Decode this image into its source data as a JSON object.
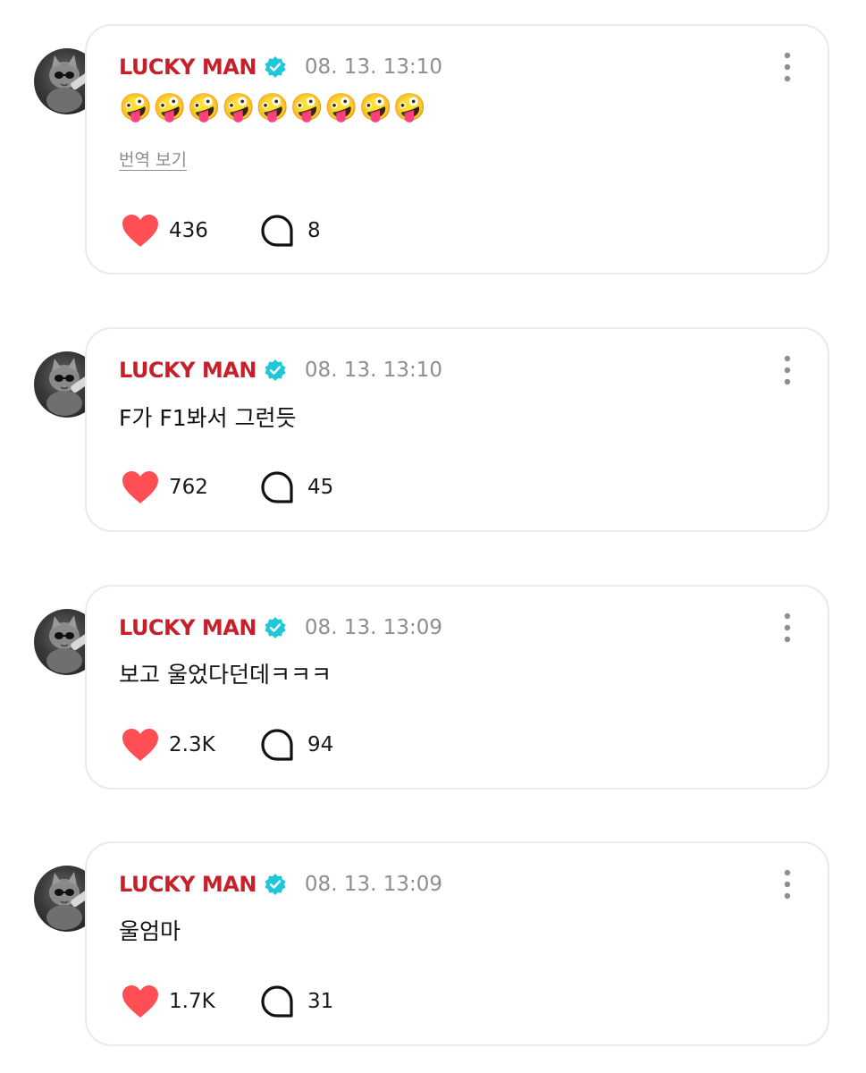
{
  "posts": [
    {
      "username": "LUCKY MAN",
      "timestamp": "08. 13. 13:10",
      "text": "🤪🤪🤪🤪🤪🤪🤪🤪🤪",
      "translate_label": "번역 보기",
      "likes": "436",
      "comments": "8"
    },
    {
      "username": "LUCKY MAN",
      "timestamp": "08. 13. 13:10",
      "text": "F가 F1봐서 그런듯",
      "likes": "762",
      "comments": "45"
    },
    {
      "username": "LUCKY MAN",
      "timestamp": "08. 13. 13:09",
      "text": "보고 울었다던데ㅋㅋㅋ",
      "likes": "2.3K",
      "comments": "94"
    },
    {
      "username": "LUCKY MAN",
      "timestamp": "08. 13. 13:09",
      "text": "울엄마",
      "likes": "1.7K",
      "comments": "31"
    }
  ],
  "colors": {
    "username": "#c8202b",
    "verified": "#1fc8d8",
    "heart": "#ff4f55",
    "timestamp": "#8d8d92",
    "card_border": "#e9e9ee"
  },
  "icons": {
    "verified": "verified-badge-icon",
    "more": "more-vertical-icon",
    "like": "heart-icon",
    "comment": "comment-bubble-icon",
    "avatar": "cat-avatar"
  }
}
